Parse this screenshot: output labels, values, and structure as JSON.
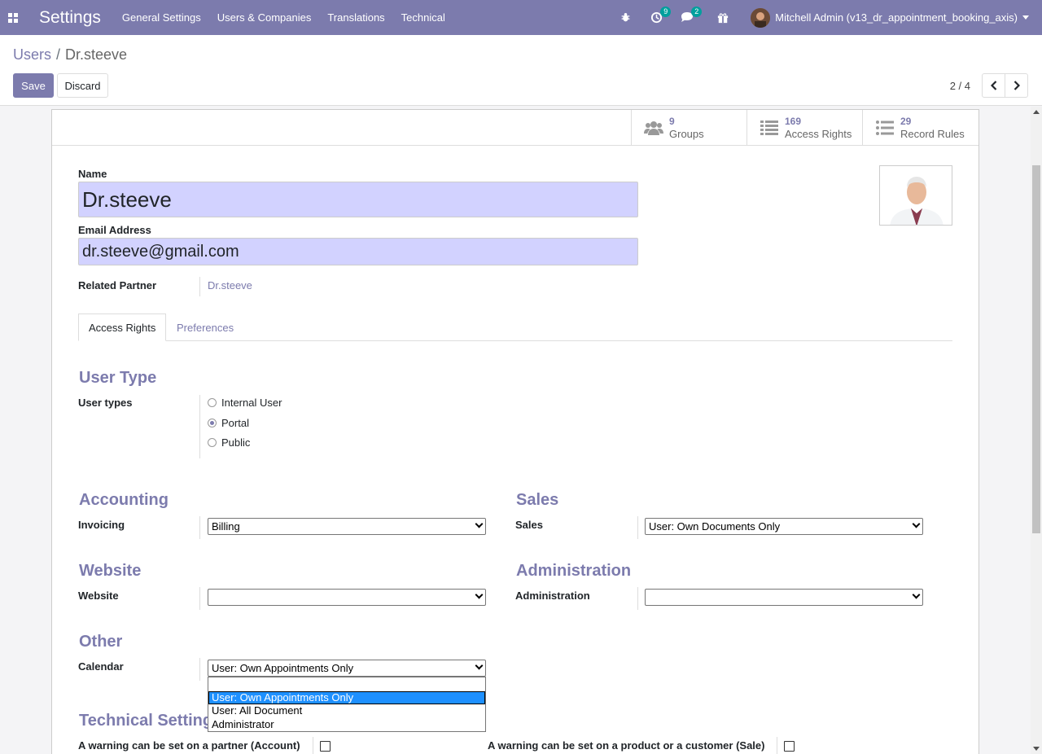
{
  "navbar": {
    "app_title": "Settings",
    "menu": [
      "General Settings",
      "Users & Companies",
      "Translations",
      "Technical"
    ],
    "activity_count": "9",
    "messages_count": "2",
    "user_name": "Mitchell Admin (v13_dr_appointment_booking_axis)"
  },
  "breadcrumb": {
    "parent": "Users",
    "current": "Dr.steeve"
  },
  "actions": {
    "save": "Save",
    "discard": "Discard"
  },
  "pager": {
    "label": "2 / 4"
  },
  "stat_buttons": [
    {
      "value": "9",
      "label": "Groups",
      "icon": "users-icon"
    },
    {
      "value": "169",
      "label": "Access Rights",
      "icon": "list-icon"
    },
    {
      "value": "29",
      "label": "Record Rules",
      "icon": "bullet-list-icon"
    }
  ],
  "form": {
    "name_label": "Name",
    "name_value": "Dr.steeve",
    "email_label": "Email Address",
    "email_value": "dr.steeve@gmail.com",
    "partner_label": "Related Partner",
    "partner_value": "Dr.steeve"
  },
  "tabs": [
    "Access Rights",
    "Preferences"
  ],
  "user_type": {
    "title": "User Type",
    "label": "User types",
    "options": [
      "Internal User",
      "Portal",
      "Public"
    ],
    "selected": "Portal"
  },
  "accounting": {
    "title": "Accounting",
    "label": "Invoicing",
    "value": "Billing"
  },
  "sales": {
    "title": "Sales",
    "label": "Sales",
    "value": "User: Own Documents Only"
  },
  "website": {
    "title": "Website",
    "label": "Website",
    "value": ""
  },
  "administration": {
    "title": "Administration",
    "label": "Administration",
    "value": ""
  },
  "other": {
    "title": "Other",
    "calendar_label": "Calendar",
    "calendar_value": "User: Own Appointments Only",
    "calendar_options": [
      "",
      "User: Own Appointments Only",
      "User: All Document",
      "Administrator"
    ]
  },
  "technical": {
    "title": "Technical Settings",
    "warning_account": "A warning can be set on a partner (Account)",
    "warning_sale": "A warning can be set on a product or a customer (Sale)"
  },
  "colors": {
    "brand": "#7c7bad",
    "badge": "#00a09d",
    "field_bg": "#d2d2ff"
  }
}
